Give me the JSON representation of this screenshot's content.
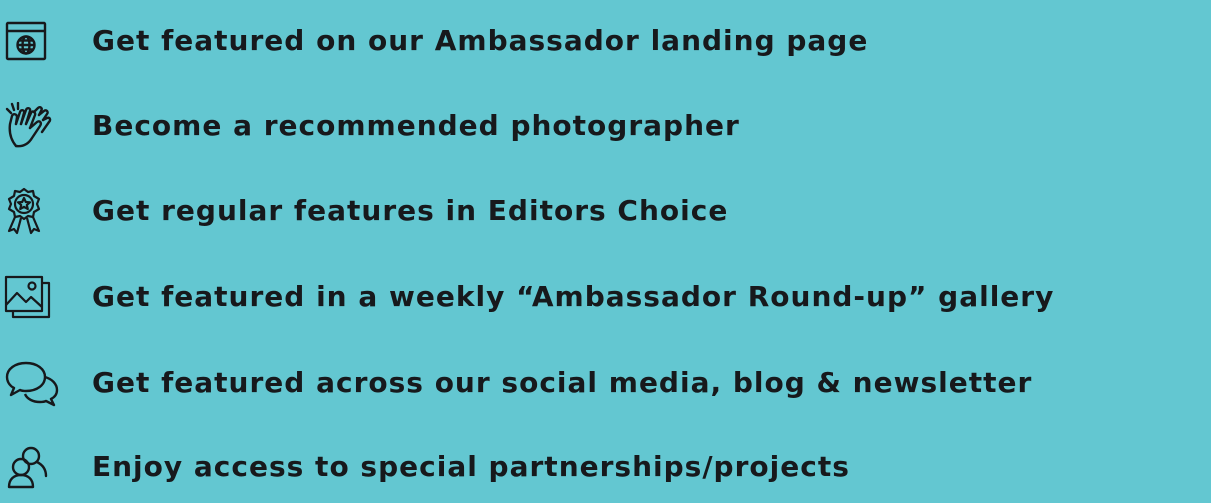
{
  "background_color": "#63c7d1",
  "text_color": "#17191c",
  "items": [
    {
      "icon": "browser-globe-icon",
      "label": "Get featured on our Ambassador landing page"
    },
    {
      "icon": "clapping-hands-icon",
      "label": "Become a recommended photographer"
    },
    {
      "icon": "award-ribbon-icon",
      "label": "Get regular features in Editors Choice"
    },
    {
      "icon": "image-gallery-icon",
      "label": "Get featured in a weekly “Ambassador Round-up” gallery"
    },
    {
      "icon": "speech-bubbles-icon",
      "label": "Get featured across our social media, blog & newsletter"
    },
    {
      "icon": "users-group-icon",
      "label": "Enjoy access to special partnerships/projects"
    }
  ]
}
